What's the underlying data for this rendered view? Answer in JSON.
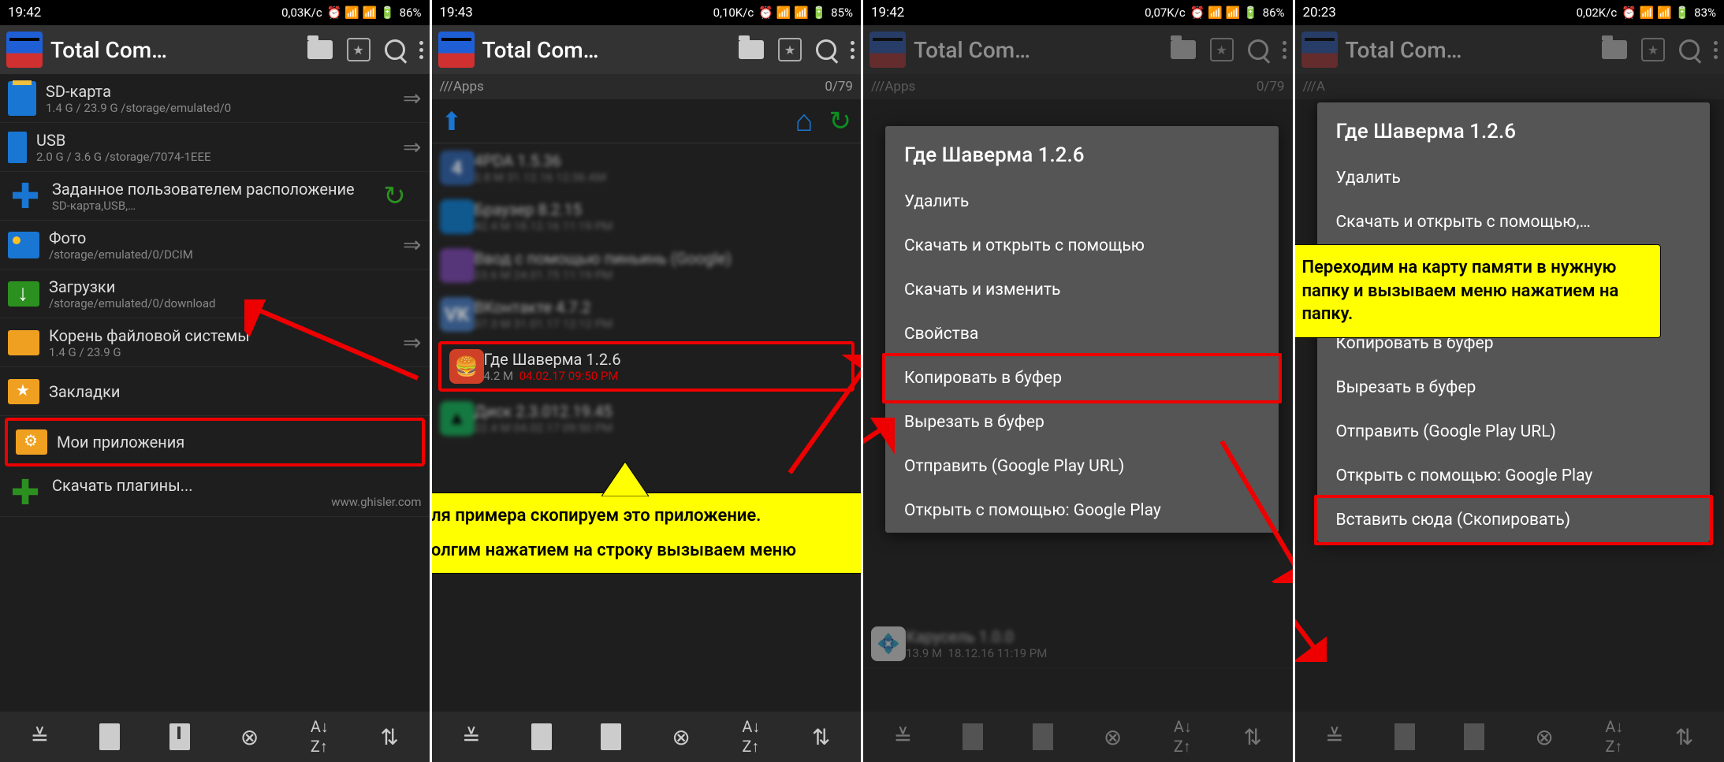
{
  "statusbar": [
    {
      "time": "19:42",
      "speed": "0,03K/c",
      "battery": "86%"
    },
    {
      "time": "19:43",
      "speed": "0,10K/c",
      "battery": "85%"
    },
    {
      "time": "19:42",
      "speed": "0,07K/c",
      "battery": "86%"
    },
    {
      "time": "20:23",
      "speed": "0,02K/c",
      "battery": "83%"
    }
  ],
  "app_title": "Total Com…",
  "screen1": {
    "rows": [
      {
        "title": "SD-карта",
        "sub": "1.4 G / 23.9 G  /storage/emulated/0"
      },
      {
        "title": "USB",
        "sub": "2.0 G / 3.6 G  /storage/7074-1EEE"
      },
      {
        "title": "Заданное пользователем расположение",
        "sub": "SD-карта,USB,…"
      },
      {
        "title": "Фото",
        "sub": "/storage/emulated/0/DCIM"
      },
      {
        "title": "Загрузки",
        "sub": "/storage/emulated/0/download"
      },
      {
        "title": "Корень файловой системы",
        "sub": "1.4 G / 23.9 G"
      },
      {
        "title": "Закладки",
        "sub": ""
      },
      {
        "title": "Мои приложения",
        "sub": ""
      },
      {
        "title": "Скачать плагины...",
        "sub": "www.ghisler.com"
      }
    ]
  },
  "screen2": {
    "path": "///Apps",
    "count": "0/79",
    "highlighted_app": {
      "name": "Где Шаверма  1.2.6",
      "size": "4.2 M",
      "date": "04.02.17  09:50 PM"
    },
    "annotation_l1": "Для примера скопируем это приложение.",
    "annotation_l2": "Долгим нажатием на строку вызываем меню"
  },
  "screen3": {
    "path": "///Apps",
    "count": "0/79",
    "menu_title": "Где Шаверма  1.2.6",
    "menu_items": [
      "Удалить",
      "Скачать и открыть с помощью",
      "Скачать и изменить",
      "Свойства",
      "Копировать в буфер",
      "Вырезать в буфер",
      "Отправить (Google Play URL)",
      "Открыть с помощью: Google Play"
    ],
    "bg_row": {
      "size": "13.9 M",
      "date": "18.12.16  11:19 PM"
    },
    "highlight_index": 4
  },
  "screen4": {
    "path": "///A",
    "menu_title": "Где Шаверма  1.2.6",
    "menu_items": [
      "Удалить",
      "Скачать и открыть с помощью,…",
      "",
      "",
      "Копировать в буфер",
      "Вырезать в буфер",
      "Отправить (Google Play URL)",
      "Открыть с помощью: Google Play",
      "Вставить сюда (Скопировать)"
    ],
    "annotation": "Переходим на карту памяти в нужную папку и вызываем меню нажатием на папку.",
    "highlight_index": 8
  },
  "bottom_icons": [
    "select",
    "copy",
    "zip",
    "cancel",
    "sort",
    "exchange"
  ]
}
